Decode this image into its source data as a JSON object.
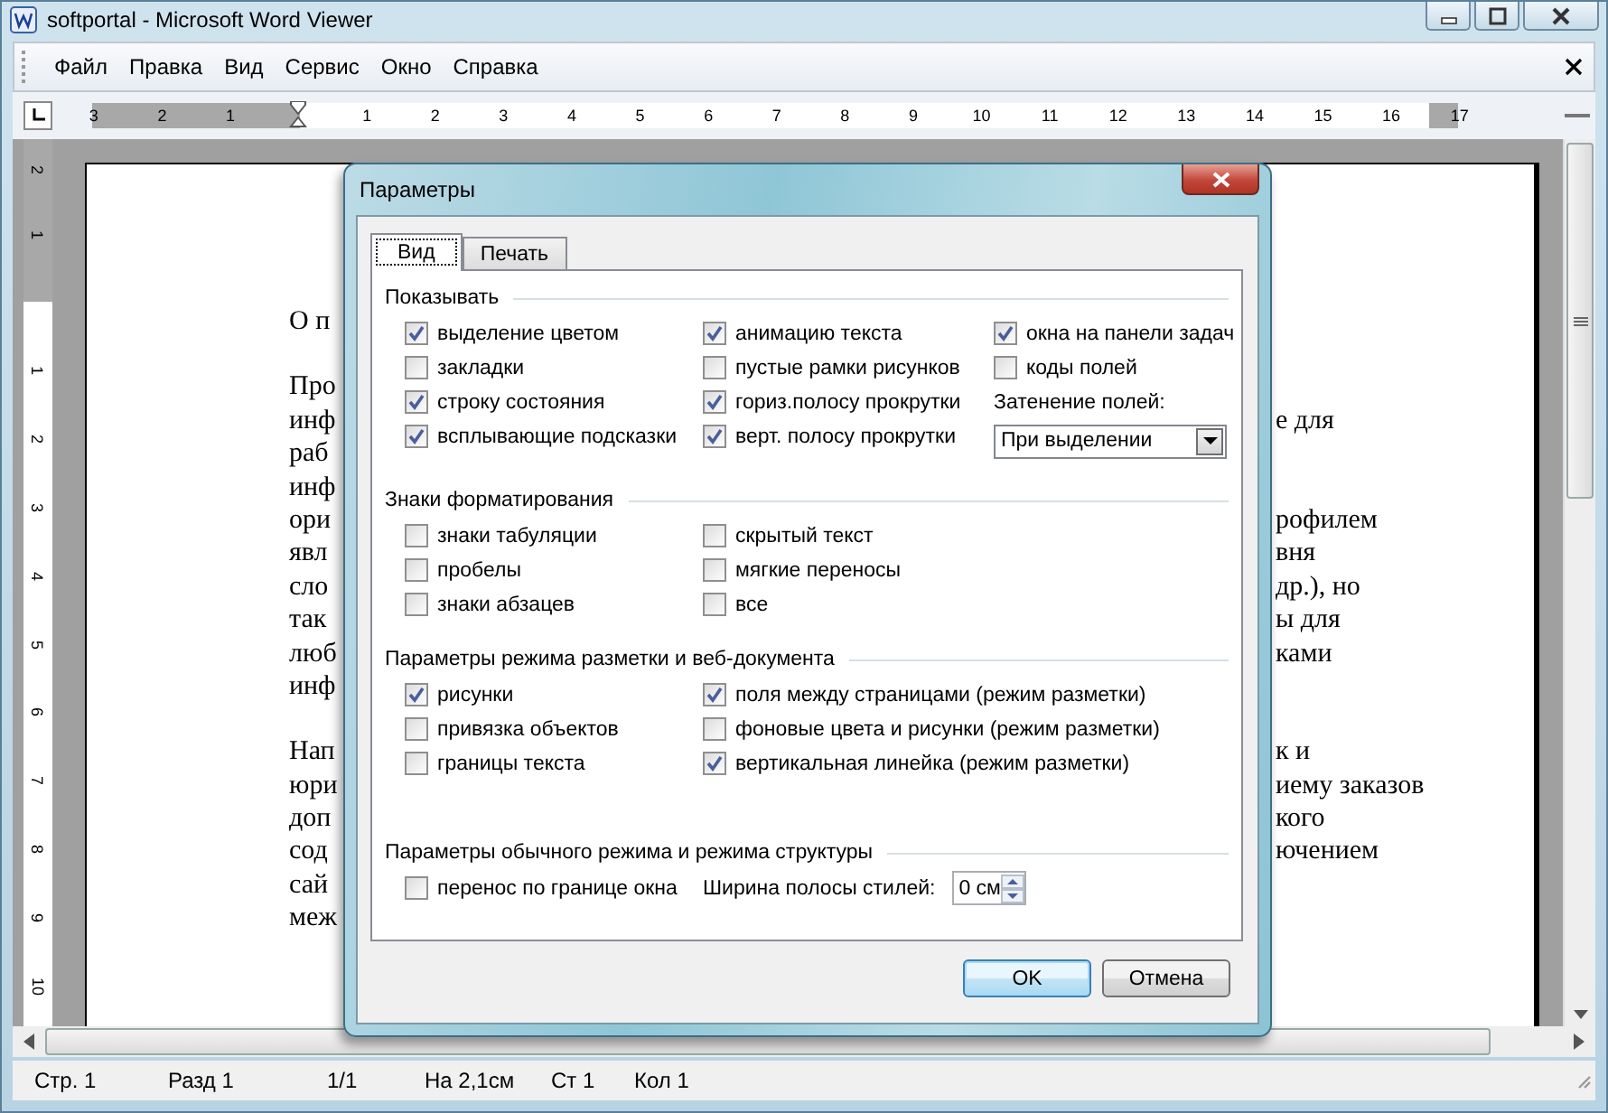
{
  "window": {
    "title": "softportal - Microsoft Word Viewer"
  },
  "menu": [
    "Файл",
    "Правка",
    "Вид",
    "Сервис",
    "Окно",
    "Справка"
  ],
  "ruler": {
    "left_marks": [
      "3",
      "2",
      "1"
    ],
    "marks": [
      "1",
      "2",
      "3",
      "4",
      "5",
      "6",
      "7",
      "8",
      "9",
      "10",
      "11",
      "12",
      "13",
      "14",
      "15",
      "16"
    ],
    "right_marks": [
      "17"
    ]
  },
  "vertical_ruler": {
    "top_marks": [
      "2",
      "1"
    ],
    "marks": [
      "1",
      "2",
      "3",
      "4",
      "5",
      "6",
      "7",
      "8",
      "9",
      "10"
    ]
  },
  "document": {
    "paragraphs": [
      {
        "lines": [
          {
            "left": "О п"
          }
        ]
      },
      {
        "lines": [
          {
            "left": "Про"
          },
          {
            "left": "инф",
            "right": "е для"
          },
          {
            "left": "раб"
          },
          {
            "left": "инф"
          },
          {
            "left": "ори",
            "right": "рофилем"
          },
          {
            "left": "явл",
            "right": "вня"
          },
          {
            "left": "сло",
            "right": "др.), но"
          },
          {
            "left": "так",
            "right": "ы для"
          },
          {
            "left": "люб",
            "right": "ками"
          },
          {
            "left": "инф"
          }
        ]
      },
      {
        "lines": [
          {
            "left": "Нап",
            "right": "к и"
          },
          {
            "left": "юри",
            "right": "иему заказов"
          },
          {
            "left": "доп",
            "right": "кого"
          },
          {
            "left": "сод",
            "right": "ючением"
          },
          {
            "left": "сай"
          },
          {
            "left": "меж"
          }
        ]
      }
    ]
  },
  "dialog": {
    "title": "Параметры",
    "tabs": [
      {
        "label": "Вид",
        "selected": true
      },
      {
        "label": "Печать",
        "selected": false
      }
    ],
    "groups": [
      {
        "title": "Показывать",
        "columns": [
          [
            {
              "kind": "checkbox",
              "label": "выделение цветом",
              "checked": true
            },
            {
              "kind": "checkbox",
              "label": "закладки",
              "checked": false
            },
            {
              "kind": "checkbox",
              "label": "строку состояния",
              "checked": true
            },
            {
              "kind": "checkbox",
              "label": "всплывающие подсказки",
              "checked": true
            }
          ],
          [
            {
              "kind": "checkbox",
              "label": "анимацию текста",
              "checked": true
            },
            {
              "kind": "checkbox",
              "label": "пустые рамки рисунков",
              "checked": false
            },
            {
              "kind": "checkbox",
              "label": "гориз.полосу прокрутки",
              "checked": true
            },
            {
              "kind": "checkbox",
              "label": "верт. полосу прокрутки",
              "checked": true
            }
          ],
          [
            {
              "kind": "checkbox",
              "label": "окна на панели задач",
              "checked": true
            },
            {
              "kind": "checkbox",
              "label": "коды полей",
              "checked": false
            },
            {
              "kind": "label",
              "label": "Затенение полей:"
            },
            {
              "kind": "dropdown",
              "value": "При выделении"
            }
          ]
        ]
      },
      {
        "title": "Знаки форматирования",
        "columns": [
          [
            {
              "kind": "checkbox",
              "label": "знаки табуляции",
              "checked": false
            },
            {
              "kind": "checkbox",
              "label": "пробелы",
              "checked": false
            },
            {
              "kind": "checkbox",
              "label": "знаки абзацев",
              "checked": false
            }
          ],
          [
            {
              "kind": "checkbox",
              "label": "скрытый текст",
              "checked": false
            },
            {
              "kind": "checkbox",
              "label": "мягкие переносы",
              "checked": false
            },
            {
              "kind": "checkbox",
              "label": "все",
              "checked": false
            }
          ]
        ]
      },
      {
        "title": "Параметры режима разметки и веб-документа",
        "columns": [
          [
            {
              "kind": "checkbox",
              "label": "рисунки",
              "checked": true
            },
            {
              "kind": "checkbox",
              "label": "привязка объектов",
              "checked": false
            },
            {
              "kind": "checkbox",
              "label": "границы текста",
              "checked": false
            }
          ],
          [
            {
              "kind": "checkbox",
              "label": "поля между страницами (режим разметки)",
              "checked": true
            },
            {
              "kind": "checkbox",
              "label": "фоновые цвета и рисунки (режим разметки)",
              "checked": false
            },
            {
              "kind": "checkbox",
              "label": "вертикальная линейка (режим разметки)",
              "checked": true
            }
          ]
        ]
      },
      {
        "title": "Параметры обычного режима и режима структуры",
        "columns": [
          [
            {
              "kind": "checkbox",
              "label": "перенос по границе окна",
              "checked": false
            }
          ],
          [
            {
              "kind": "spinner",
              "label": "Ширина полосы стилей:",
              "value": "0 см"
            }
          ]
        ]
      }
    ],
    "buttons": [
      {
        "label": "OK",
        "default": true
      },
      {
        "label": "Отмена",
        "default": false
      }
    ]
  },
  "status_bar": [
    "Стр. 1",
    "Разд 1",
    "1/1",
    "На 2,1см",
    "Ст 1",
    "Кол 1"
  ]
}
